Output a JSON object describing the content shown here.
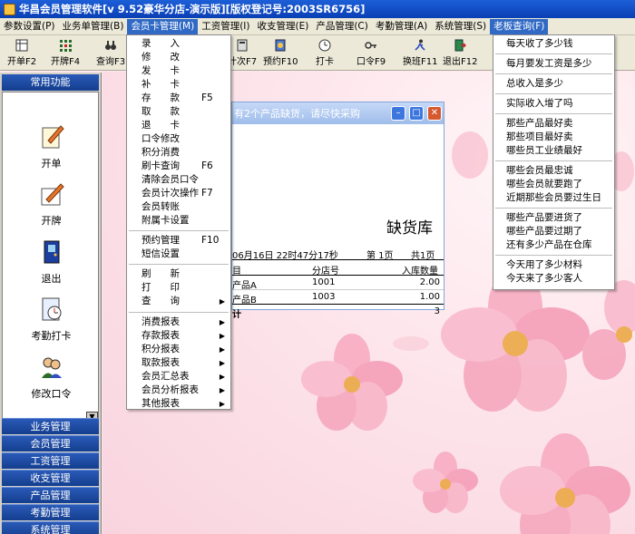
{
  "window": {
    "title": "华昌会员管理软件[v 9.52豪华分店-演示版][版权登记号:2003SR6756]"
  },
  "menubar": [
    "参数设置(P)",
    "业务单管理(B)",
    "会员卡管理(M)",
    "工资管理(I)",
    "收支管理(E)",
    "产品管理(C)",
    "考勤管理(A)",
    "系统管理(S)",
    "老板查询(F)"
  ],
  "toolbar": {
    "kaidan": "开单F2",
    "kaipai": "开牌F4",
    "chaxun": "查询F3",
    "jici": "计次F7",
    "yuyue": "预约F10",
    "daka": "打卡",
    "kouling": "口令F9",
    "huanban": "换班F11",
    "tuichu": "退出F12"
  },
  "sidebar": {
    "header": "常用功能",
    "tools": [
      "开单",
      "开牌",
      "退出",
      "考勤打卡",
      "修改口令"
    ],
    "groups": [
      "业务管理",
      "会员管理",
      "工资管理",
      "收支管理",
      "产品管理",
      "考勤管理",
      "系统管理"
    ]
  },
  "report": {
    "title": "有2个产品缺货，请尽快采购",
    "heading": "缺货库",
    "date": "06月16日 22时47分17秒",
    "page": "第 1页",
    "total_pages": "共1页",
    "columns": [
      "目",
      "分店号",
      "入库数量"
    ],
    "rows": [
      {
        "name": "产品A",
        "store": "1001",
        "qty": "2.00"
      },
      {
        "name": "产品B",
        "store": "1003",
        "qty": "1.00"
      }
    ],
    "total_label": "计",
    "total_value": "3"
  },
  "member_menu": {
    "items": [
      "录　　入",
      "修　　改",
      "发　　卡",
      "补　　卡",
      "存　　款",
      "取　　款",
      "退　　卡",
      "口令修改",
      "积分消费",
      "刷卡查询",
      "清除会员口令",
      "会员计次操作",
      "会员转账",
      "附属卡设置",
      "预约管理",
      "短信设置",
      "刷　　新",
      "打　　印",
      "查　　询",
      "消费报表",
      "存款报表",
      "积分报表",
      "取款报表",
      "会员汇总表",
      "会员分析报表",
      "其他报表"
    ],
    "shortcuts": {
      "deposit": "F5",
      "query": "F6",
      "count": "F7",
      "booking": "F10"
    }
  },
  "boss_menu": {
    "items": [
      "每天收了多少钱",
      "每月要发工资是多少",
      "总收入是多少",
      "实际收入增了吗",
      "那些产品最好卖",
      "那些项目最好卖",
      "哪些员工业绩最好",
      "哪些会员最忠诚",
      "哪些会员就要跑了",
      "近期那些会员要过生日",
      "哪些产品要进货了",
      "哪些产品要过期了",
      "还有多少产品在仓库",
      "今天用了多少材料",
      "今天来了多少客人"
    ]
  },
  "colors": {
    "menu_highlight": "#316ac5",
    "sidebar_blue": "#143e8e",
    "background_pink": "#f9d4de"
  }
}
